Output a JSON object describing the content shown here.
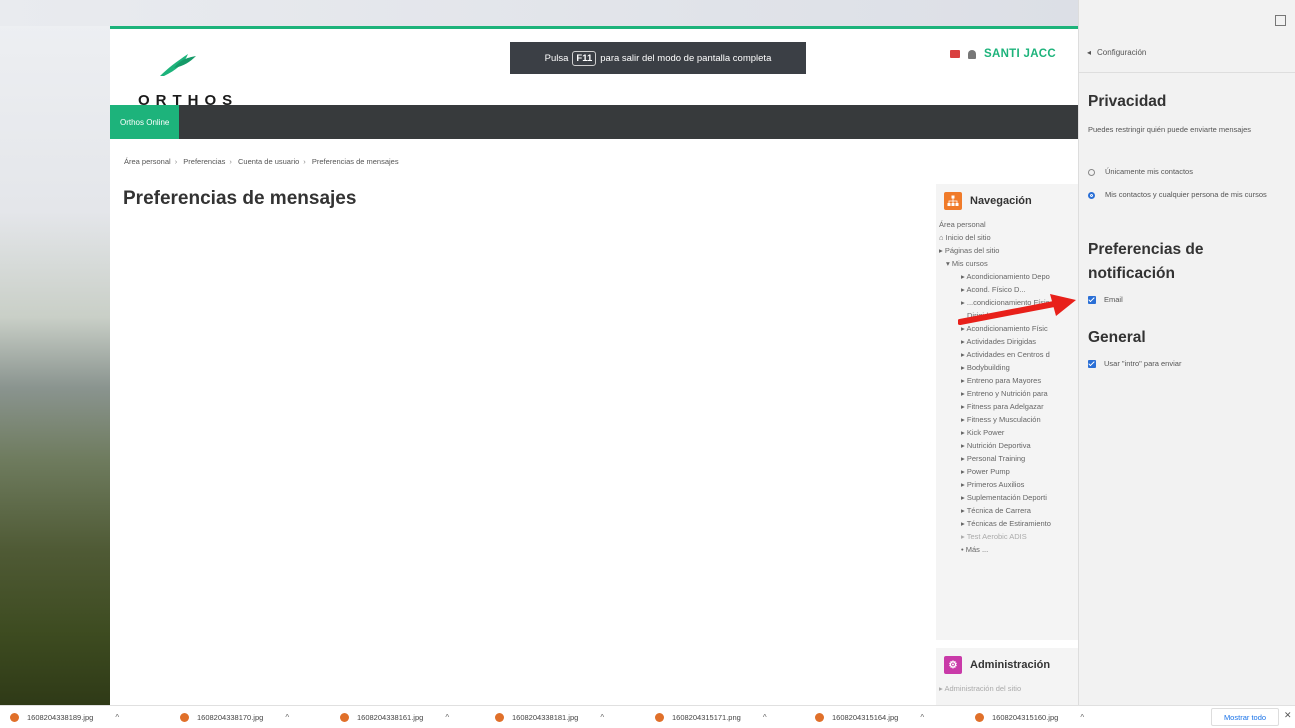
{
  "header": {
    "logo_text": "ORTHOS",
    "fullscreen_toast": {
      "before": "Pulsa",
      "key": "F11",
      "after": "para salir del modo de pantalla completa"
    },
    "user_name": "SANTI JACC"
  },
  "navbar": {
    "tab_label": "Orthos Online"
  },
  "breadcrumb": [
    "Área personal",
    "Preferencias",
    "Cuenta de usuario",
    "Preferencias de mensajes"
  ],
  "page_title": "Preferencias de mensajes",
  "navigation_block": {
    "title": "Navegación",
    "items": [
      {
        "label": "Área personal",
        "level": "l1",
        "icon": ""
      },
      {
        "label": "Inicio del sitio",
        "level": "l1",
        "icon": "home-icon"
      },
      {
        "label": "Páginas del sitio",
        "level": "l1",
        "icon": "triangle-right-icon"
      },
      {
        "label": "Mis cursos",
        "level": "l2",
        "icon": "triangle-down-icon"
      },
      {
        "label": "Acondicionamiento Depo",
        "level": "l3",
        "icon": "triangle-right-icon"
      },
      {
        "label": "Acond. Físico D...",
        "level": "l3",
        "icon": "triangle-right-icon"
      },
      {
        "label": "...condicionamiento Físic",
        "level": "l3",
        "icon": "triangle-right-icon"
      },
      {
        "label": "Dirigidas",
        "level": "l3b",
        "icon": ""
      },
      {
        "label": "Acondicionamiento Físic",
        "level": "l3",
        "icon": "triangle-right-icon"
      },
      {
        "label": "Actividades Dirigidas",
        "level": "l3",
        "icon": "triangle-right-icon"
      },
      {
        "label": "Actividades en Centros d",
        "level": "l3",
        "icon": "triangle-right-icon"
      },
      {
        "label": "Bodybuilding",
        "level": "l3",
        "icon": "triangle-right-icon"
      },
      {
        "label": "Entreno para Mayores",
        "level": "l3",
        "icon": "triangle-right-icon"
      },
      {
        "label": "Entreno y Nutrición para",
        "level": "l3",
        "icon": "triangle-right-icon"
      },
      {
        "label": "Fitness para Adelgazar",
        "level": "l3",
        "icon": "triangle-right-icon"
      },
      {
        "label": "Fitness y Musculación",
        "level": "l3",
        "icon": "triangle-right-icon"
      },
      {
        "label": "Kick Power",
        "level": "l3",
        "icon": "triangle-right-icon"
      },
      {
        "label": "Nutrición Deportiva",
        "level": "l3",
        "icon": "triangle-right-icon"
      },
      {
        "label": "Personal Training",
        "level": "l3",
        "icon": "triangle-right-icon"
      },
      {
        "label": "Power Pump",
        "level": "l3",
        "icon": "triangle-right-icon"
      },
      {
        "label": "Primeros Auxilios",
        "level": "l3",
        "icon": "triangle-right-icon"
      },
      {
        "label": "Suplementación Deporti",
        "level": "l3",
        "icon": "triangle-right-icon"
      },
      {
        "label": "Técnica de Carrera",
        "level": "l3",
        "icon": "triangle-right-icon"
      },
      {
        "label": "Técnicas de Estiramiento",
        "level": "l3",
        "icon": "triangle-right-icon"
      },
      {
        "label": "Test Aerobic ADIS",
        "level": "l3",
        "icon": "triangle-right-icon",
        "dim": true
      },
      {
        "label": "Más ...",
        "level": "l3",
        "icon": "bullet-icon"
      }
    ]
  },
  "admin_block": {
    "title": "Administración",
    "first_item": "Administración del sitio"
  },
  "drawer": {
    "back_label": "Configuración",
    "privacy_heading": "Privacidad",
    "privacy_desc": "Puedes restringir quién puede enviarte mensajes",
    "radio_options": [
      {
        "label": "Únicamente mis contactos",
        "selected": false
      },
      {
        "label": "Mis contactos y cualquier persona de mis cursos",
        "selected": true
      }
    ],
    "notif_heading": "Preferencias de notificación",
    "email_label": "Email",
    "general_heading": "General",
    "enter_label": "Usar \"intro\" para enviar"
  },
  "downloads": [
    "1608204338189.jpg",
    "1608204338170.jpg",
    "1608204338161.jpg",
    "1608204338181.jpg",
    "1608204315171.png",
    "1608204315164.jpg",
    "1608204315160.jpg"
  ],
  "downloads_bar": {
    "show_all_label": "Mostrar todo"
  },
  "colors": {
    "brand_green": "#1db37b",
    "navbar_dark": "#373a3c",
    "arrow_red": "#e8201a",
    "check_blue": "#2a6fd6"
  }
}
